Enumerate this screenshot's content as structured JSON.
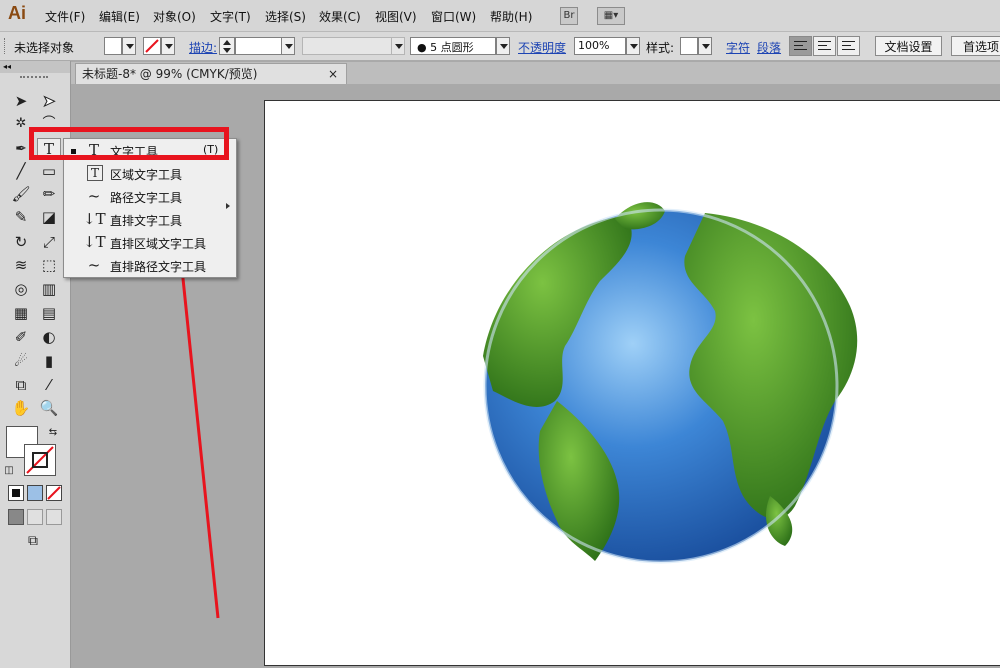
{
  "app": {
    "logo": "Ai"
  },
  "menubar": {
    "items": [
      "文件(F)",
      "编辑(E)",
      "对象(O)",
      "文字(T)",
      "选择(S)",
      "效果(C)",
      "视图(V)",
      "窗口(W)",
      "帮助(H)"
    ],
    "bridge_label": "Br"
  },
  "controlbar": {
    "selection_status": "未选择对象",
    "stroke_label": "描边:",
    "brush_value": "5 点圆形",
    "opacity_label": "不透明度",
    "opacity_value": "100%",
    "style_label": "样式:",
    "character_label": "字符",
    "paragraph_label": "段落",
    "doc_setup_button": "文档设置",
    "preferences_button": "首选项"
  },
  "document": {
    "tab_title": "未标题-8* @ 99% (CMYK/预览)",
    "close_glyph": "×"
  },
  "flyout": {
    "items": [
      {
        "label": "文字工具",
        "shortcut": "(T)",
        "icon": "T"
      },
      {
        "label": "区域文字工具",
        "icon": "T"
      },
      {
        "label": "路径文字工具",
        "icon": "~"
      },
      {
        "label": "直排文字工具",
        "icon": "↓T"
      },
      {
        "label": "直排区域文字工具",
        "icon": "↓T"
      },
      {
        "label": "直排路径文字工具",
        "icon": "~"
      }
    ]
  },
  "colors": {
    "highlight": "#e8141e",
    "arrow": "#e8141e",
    "link": "#1d44b3",
    "ocean": "#2f6fc4",
    "land": "#3f8a22"
  }
}
